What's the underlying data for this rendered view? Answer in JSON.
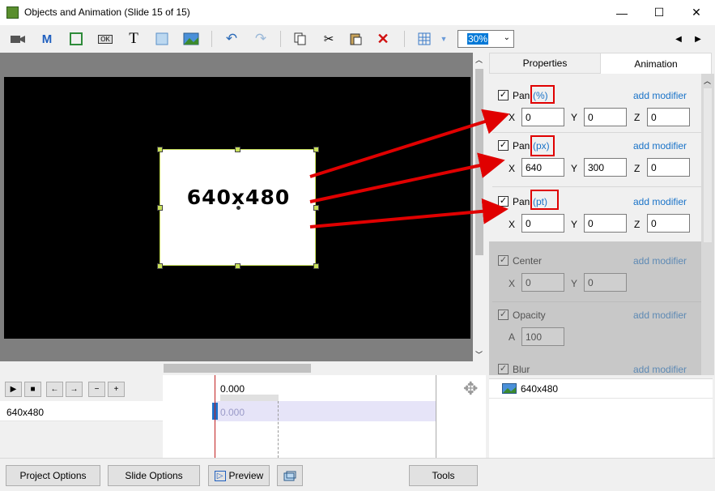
{
  "window": {
    "title": "Objects and Animation (Slide 15 of 15)",
    "minimize": "—",
    "maximize": "☐",
    "close": "✕"
  },
  "toolbar": {
    "zoom_value": "30%",
    "m_label": "M",
    "t_label": "T",
    "ok_label": "OK"
  },
  "canvas": {
    "object_text": "640x480"
  },
  "tabs": {
    "properties": "Properties",
    "animation": "Animation"
  },
  "panel": {
    "pan_pct": {
      "label": "Pan",
      "unit": "(%)",
      "x": "0",
      "y": "0",
      "z": "0",
      "add": "add modifier"
    },
    "pan_px": {
      "label": "Pan",
      "unit": "(px)",
      "x": "640",
      "y": "300",
      "z": "0",
      "add": "add modifier"
    },
    "pan_pt": {
      "label": "Pan",
      "unit": "(pt)",
      "x": "0",
      "y": "0",
      "z": "0",
      "add": "add modifier"
    },
    "center": {
      "label": "Center",
      "x": "0",
      "y": "0",
      "add": "add modifier"
    },
    "opacity": {
      "label": "Opacity",
      "a": "100",
      "add": "add modifier"
    },
    "blur": {
      "label": "Blur",
      "add": "add modifier"
    },
    "axis_x": "X",
    "axis_y": "Y",
    "axis_z": "Z",
    "axis_a": "A"
  },
  "timeline": {
    "time_top": "0.000",
    "time_track": "0.000",
    "track_name": "640x480"
  },
  "object_list": {
    "items": [
      "640x480"
    ]
  },
  "bottom": {
    "project_options": "Project Options",
    "slide_options": "Slide Options",
    "preview": "Preview",
    "tools": "Tools"
  },
  "colors": {
    "annotation_red": "#e00000",
    "link_blue": "#1a73c8",
    "selection_blue": "#0078d7"
  }
}
